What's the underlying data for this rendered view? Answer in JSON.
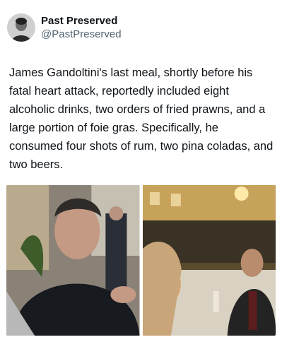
{
  "account": {
    "display_name": "Past Preserved",
    "handle": "@PastPreserved",
    "avatar_icon": "portrait-avatar"
  },
  "tweet": {
    "text": "James Gandoltini's last meal, shortly before his fatal heart attack, reportedly included eight alcoholic drinks, two orders of fried prawns, and a large portion of foie gras. Specifically, he consumed four shots of rum, two pina coladas, and two beers."
  },
  "media": {
    "photos": [
      {
        "subject": "man-seated-indoors-photo"
      },
      {
        "subject": "outdoor-dinner-crowd-photo"
      }
    ]
  },
  "colors": {
    "text": "#0f1419",
    "secondary_text": "#536471",
    "background": "#ffffff"
  }
}
